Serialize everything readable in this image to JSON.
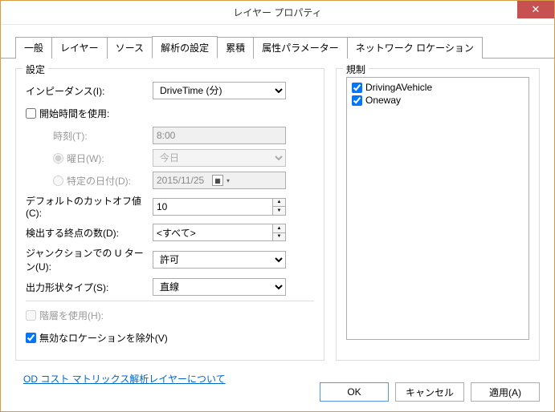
{
  "window": {
    "title": "レイヤー プロパティ"
  },
  "tabs": {
    "t0": "一般",
    "t1": "レイヤー",
    "t2": "ソース",
    "t3": "解析の設定",
    "t4": "累積",
    "t5": "属性パラメーター",
    "t6": "ネットワーク ロケーション"
  },
  "settings": {
    "legend": "設定",
    "impedance_label": "インピーダンス(I):",
    "impedance_value": "DriveTime (分)",
    "use_start_label": "開始時間を使用:",
    "time_label": "時刻(T):",
    "time_value": "8:00",
    "dow_label": "曜日(W):",
    "dow_value": "今日",
    "date_label": "特定の日付(D):",
    "date_value": "2015/11/25",
    "cutoff_label": "デフォルトのカットオフ値(C):",
    "cutoff_value": "10",
    "count_label": "検出する終点の数(D):",
    "count_value": "<すべて>",
    "uturn_label": "ジャンクションでの U ターン(U):",
    "uturn_value": "許可",
    "shape_label": "出力形状タイプ(S):",
    "shape_value": "直線",
    "hierarchy_label": "階層を使用(H):",
    "ignore_invalid_label": "無効なロケーションを除外(V)"
  },
  "restrictions": {
    "legend": "規制",
    "r0": "DrivingAVehicle",
    "r1": "Oneway"
  },
  "link": "OD コスト マトリックス解析レイヤーについて",
  "buttons": {
    "ok": "OK",
    "cancel": "キャンセル",
    "apply": "適用(A)"
  }
}
